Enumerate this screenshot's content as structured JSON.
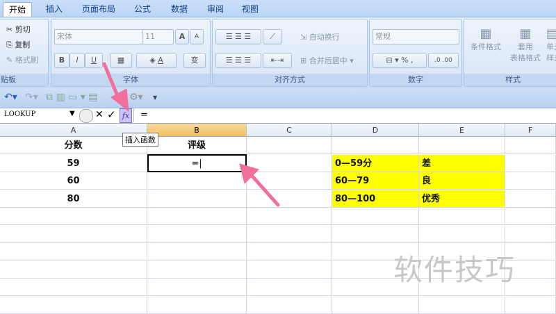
{
  "tabs": [
    "开始",
    "插入",
    "页面布局",
    "公式",
    "数据",
    "审阅",
    "视图"
  ],
  "clipboard": {
    "cut": "剪切",
    "copy": "复制",
    "format_painter": "格式刷",
    "label": "贴板"
  },
  "font": {
    "name": "宋体",
    "size": "11",
    "bold": "B",
    "italic": "I",
    "underline": "U",
    "font_color": "A",
    "phonetic": "变",
    "grow": "A",
    "shrink": "A",
    "label": "字体"
  },
  "alignment": {
    "wrap": "自动换行",
    "merge": "合并后居中",
    "label": "对齐方式"
  },
  "number": {
    "format": "常规",
    "percent": "%",
    "comma": ",",
    "label": "数字"
  },
  "styles": {
    "conditional": "条件格式",
    "table": "套用",
    "table2": "表格格式",
    "cell": "单元",
    "cell2": "样式",
    "label": "样式"
  },
  "formula_bar": {
    "name_box": "LOOKUP",
    "cancel": "✕",
    "enter": "✓",
    "fx": "fx",
    "content": "="
  },
  "tooltip": "插入函数",
  "columns": [
    "A",
    "B",
    "C",
    "D",
    "E",
    "F"
  ],
  "rows": [
    {
      "a": "分数",
      "b": "评级",
      "d": "",
      "e": ""
    },
    {
      "a": "59",
      "b": "=|",
      "d": "0—59分",
      "e": "差"
    },
    {
      "a": "60",
      "b": "",
      "d": "60—79",
      "e": "良"
    },
    {
      "a": "80",
      "b": "",
      "d": "80—100",
      "e": "优秀"
    }
  ],
  "watermark": "软件技巧",
  "colors": {
    "highlight": "#ffff00",
    "arrow": "#f06f9c",
    "selected_header": "#f1c15f"
  }
}
